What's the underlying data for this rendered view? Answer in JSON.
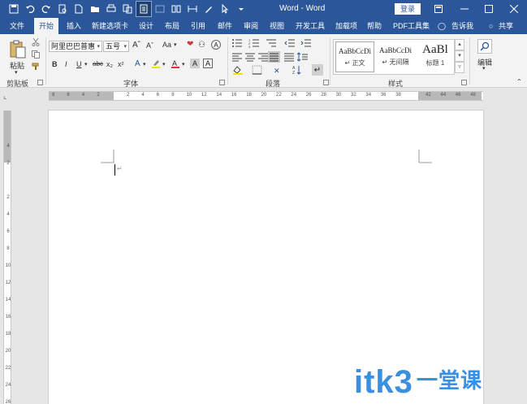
{
  "window": {
    "title": "Word - Word",
    "login": "登录"
  },
  "tabs": [
    "文件",
    "开始",
    "插入",
    "新建选项卡",
    "设计",
    "布局",
    "引用",
    "邮件",
    "审阅",
    "视图",
    "开发工具",
    "加载项",
    "帮助",
    "PDF工具集",
    "告诉我",
    "共享"
  ],
  "active_tab": "开始",
  "ribbon": {
    "clipboard": {
      "paste": "粘贴",
      "label": "剪贴板"
    },
    "font": {
      "name": "阿里巴巴普惠",
      "size": "五号",
      "label": "字体",
      "case_btn": "Aa",
      "bold": "B",
      "italic": "I",
      "underline": "U",
      "strike": "abc",
      "sub": "x₂",
      "sup": "x²"
    },
    "paragraph": {
      "label": "段落"
    },
    "styles": {
      "label": "样式",
      "items": [
        {
          "sample": "AaBbCcDi",
          "name": "↵ 正文"
        },
        {
          "sample": "AaBbCcDi",
          "name": "↵ 无间隔"
        },
        {
          "sample": "AaBl",
          "name": "标题 1"
        }
      ]
    },
    "editing": {
      "label": "编辑"
    }
  },
  "ruler": {
    "h_numbers": [
      "8",
      "6",
      "4",
      "2",
      "",
      "2",
      "4",
      "6",
      "8",
      "10",
      "12",
      "14",
      "16",
      "18",
      "20",
      "22",
      "24",
      "26",
      "28",
      "30",
      "32",
      "34",
      "36",
      "38",
      "",
      "42",
      "44",
      "46",
      "48"
    ],
    "v_numbers": [
      "",
      "4",
      "2",
      "",
      "2",
      "4",
      "6",
      "8",
      "10",
      "12",
      "14",
      "16",
      "18",
      "20",
      "22",
      "24",
      "26"
    ]
  },
  "watermark": {
    "main": "itk3",
    "sub": "一堂课"
  },
  "colors": {
    "accent": "#2b579a",
    "ribbon_bg": "#f3f3f3",
    "page": "#ffffff",
    "canvas": "#e6e6e6"
  }
}
